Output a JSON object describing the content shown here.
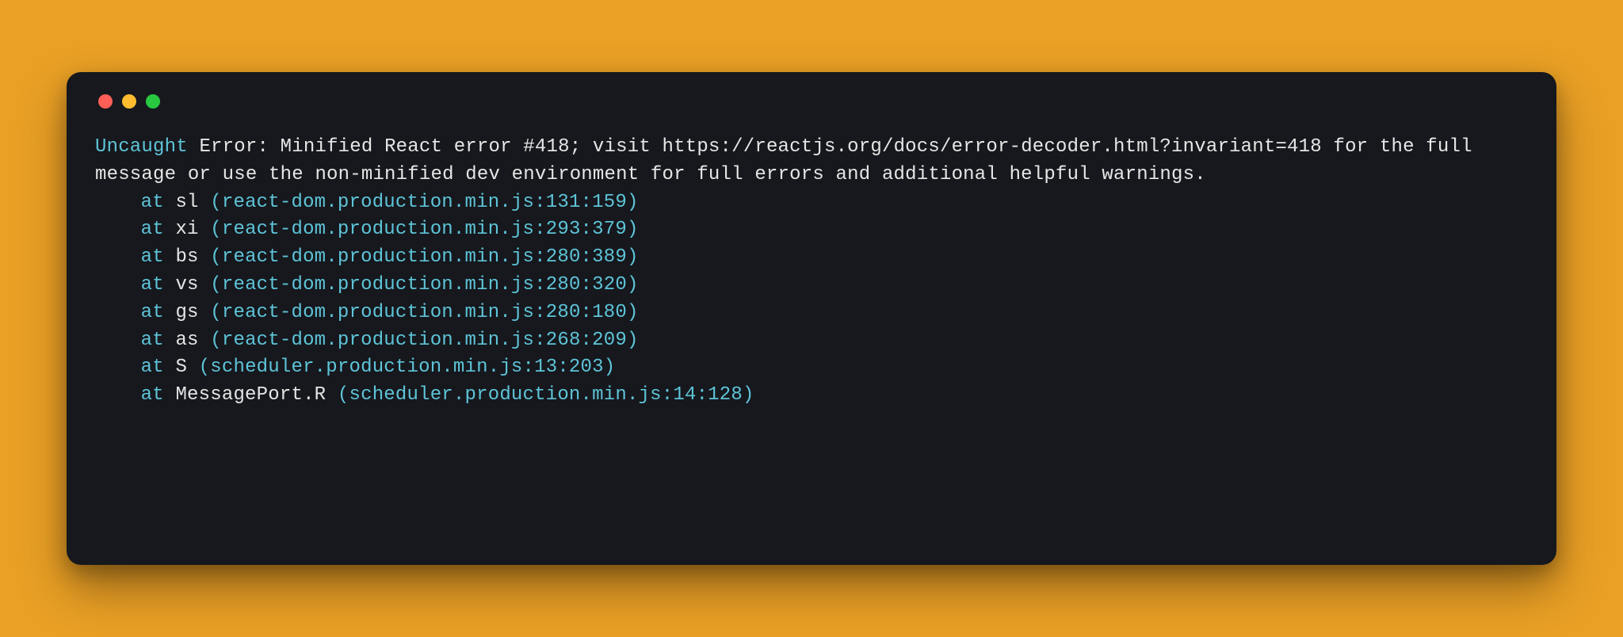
{
  "colors": {
    "background": "#eaa025",
    "terminal_bg": "#16181d",
    "text_primary": "#e6e6e6",
    "text_accent": "#5ec4d8",
    "traffic_close": "#ff5f57",
    "traffic_min": "#febc2e",
    "traffic_max": "#28c840"
  },
  "console": {
    "uncaught_label": "Uncaught",
    "error_message": "Error: Minified React error #418; visit https://reactjs.org/docs/error-decoder.html?invariant=418 for the full message or use the non-minified dev environment for full errors and additional helpful warnings.",
    "at_label": "at",
    "stack": [
      {
        "func": "sl",
        "loc": "(react-dom.production.min.js:131:159)"
      },
      {
        "func": "xi",
        "loc": "(react-dom.production.min.js:293:379)"
      },
      {
        "func": "bs",
        "loc": "(react-dom.production.min.js:280:389)"
      },
      {
        "func": "vs",
        "loc": "(react-dom.production.min.js:280:320)"
      },
      {
        "func": "gs",
        "loc": "(react-dom.production.min.js:280:180)"
      },
      {
        "func": "as",
        "loc": "(react-dom.production.min.js:268:209)"
      },
      {
        "func": "S",
        "loc": "(scheduler.production.min.js:13:203)"
      },
      {
        "func": "MessagePort.R",
        "loc": "(scheduler.production.min.js:14:128)"
      }
    ]
  }
}
